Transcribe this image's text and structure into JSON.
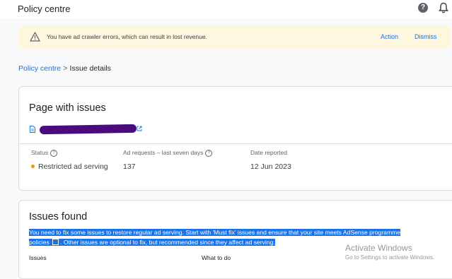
{
  "header": {
    "title": "Policy centre",
    "help_icon": "help-icon",
    "bell_icon": "notifications-icon"
  },
  "banner": {
    "icon": "warning-icon",
    "message": "You have ad crawler errors, which can result in lost revenue.",
    "action_label": "Action",
    "dismiss_label": "Dismiss"
  },
  "breadcrumb": {
    "root": "Policy centre",
    "separator": ">",
    "current": "Issue details"
  },
  "page_card": {
    "title": "Page with issues",
    "url": "redacted",
    "columns": [
      {
        "label": "Status",
        "value": "Restricted ad serving"
      },
      {
        "label": "Ad requests – last seven days",
        "value": "137"
      },
      {
        "label": "Date reported",
        "value": "12 Jun 2023"
      }
    ],
    "status_color": "#f29900"
  },
  "issues_card": {
    "title": "Issues found",
    "description_line1": "You need to fix some issues to restore regular ad serving. Start with 'Must fix' issues and ensure that your site meets AdSense programme",
    "description_link": "policies",
    "description_line2_rest": ". Other issues are optional to fix, but recommended since they affect ad serving.",
    "table_headers": [
      "Issues",
      "What to do"
    ]
  },
  "watermark": {
    "title": "Activate Windows",
    "subtitle": "Go to Settings to activate Windows."
  },
  "colors": {
    "accent": "#1a73e8",
    "banner_bg": "#fef7e0",
    "selection": "#1a73e8"
  }
}
